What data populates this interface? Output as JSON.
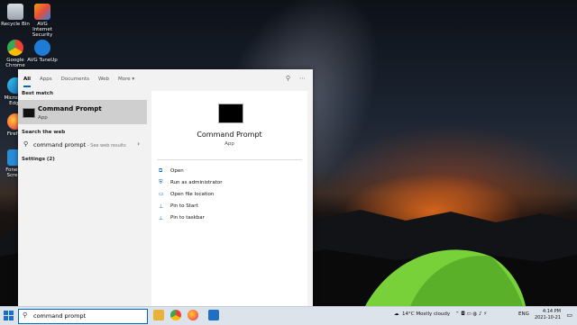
{
  "desktop": {
    "icons": [
      {
        "label": "Recycle Bin"
      },
      {
        "label": "AVG Internet Security"
      },
      {
        "label": "Google Chrome"
      },
      {
        "label": "AVG TuneUp"
      },
      {
        "label": "Microsoft Edge"
      },
      {
        "label": "Firefox"
      },
      {
        "label": "Fonelab Screen"
      }
    ]
  },
  "search": {
    "tabs": [
      "All",
      "Apps",
      "Documents",
      "Web",
      "More"
    ],
    "best_match_header": "Best match",
    "best_match": {
      "title": "Command Prompt",
      "type": "App"
    },
    "web_header": "Search the web",
    "web_query": "command prompt",
    "web_suffix": " - See web results",
    "settings_header": "Settings (2)",
    "detail": {
      "title": "Command Prompt",
      "type": "App",
      "actions": [
        "Open",
        "Run as administrator",
        "Open file location",
        "Pin to Start",
        "Pin to taskbar"
      ]
    }
  },
  "taskbar": {
    "search_value": "command prompt",
    "weather": "14°C  Mostly cloudy",
    "language": "ENG",
    "time": "4:14 PM",
    "date": "2021-10-21"
  }
}
